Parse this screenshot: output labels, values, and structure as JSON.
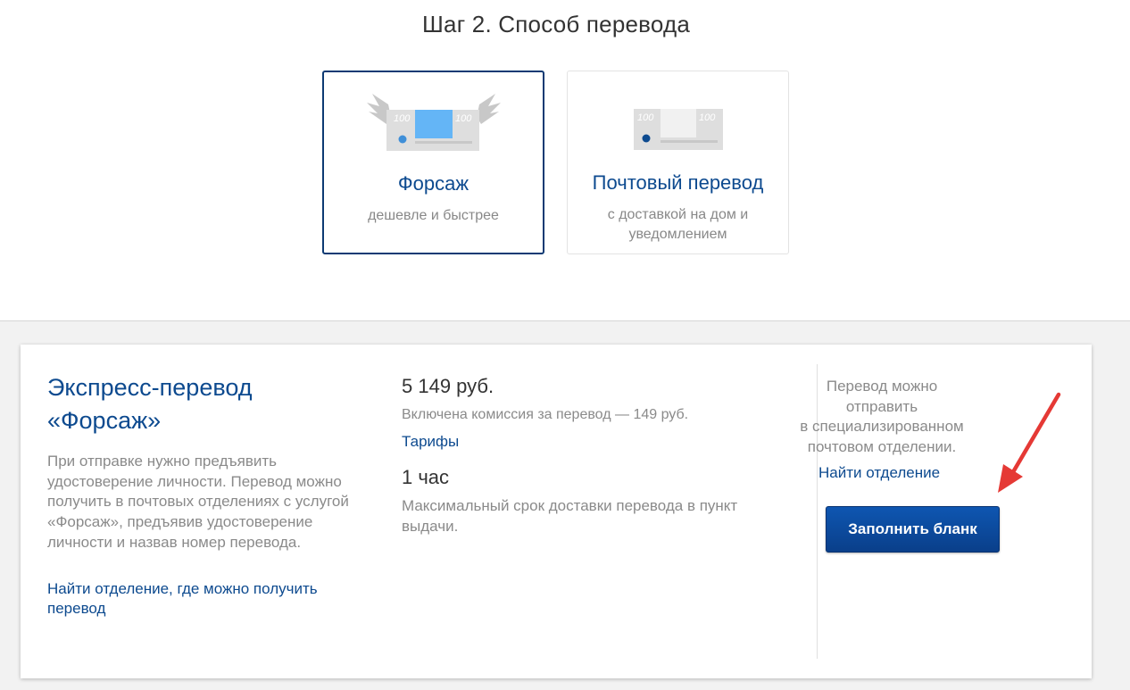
{
  "step_title": "Шаг 2. Способ перевода",
  "options": [
    {
      "title": "Форсаж",
      "subtitle": "дешевле и быстрее",
      "selected": true,
      "note_value": "100"
    },
    {
      "title": "Почтовый перевод",
      "subtitle": "с доставкой на дом и уведомлением",
      "selected": false,
      "note_value": "100"
    }
  ],
  "panel": {
    "title": "Экспресс-перевод «Форсаж»",
    "description": "При отправке нужно предъявить удостоверение личности. Перевод можно получить в почтовых отделениях с услугой «Форсаж», предъявив удостоверение личности и назвав номер перевода.",
    "find_office_link": "Найти отделение, где можно получить перевод",
    "price": "5 149 руб.",
    "commission": "Включена комиссия за перевод — 149  руб.",
    "tariffs_link": "Тарифы",
    "duration": "1 час",
    "duration_desc": "Максимальный срок доставки перевода в пункт выдачи.",
    "right_text_lines": [
      "Перевод можно",
      "отправить",
      "в специализированном",
      "почтовом отделении."
    ],
    "right_link": "Найти отделение",
    "fill_button": "Заполнить бланк"
  },
  "colors": {
    "brand_blue": "#0d4a8f",
    "button_blue": "#0a4a9f",
    "arrow_red": "#e53935",
    "muted_text": "#8a8a8a"
  }
}
